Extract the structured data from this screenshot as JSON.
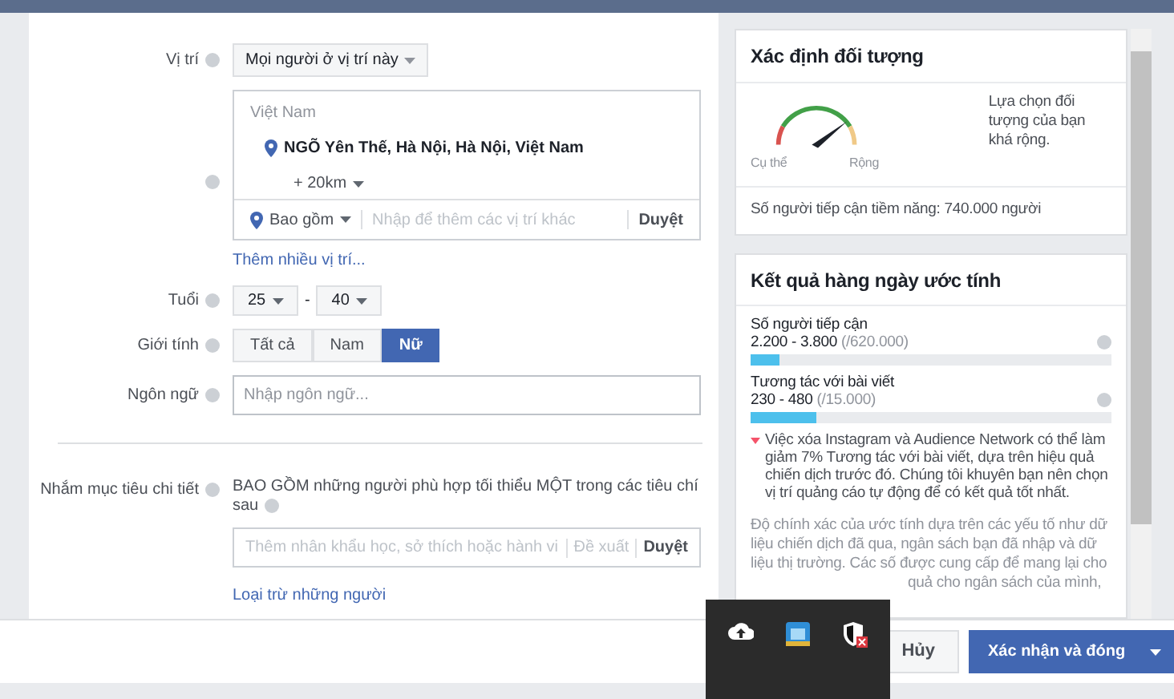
{
  "form": {
    "location": {
      "label": "Vị trí",
      "mode": "Mọi người ở vị trí này",
      "country": "Việt Nam",
      "place": "NGÕ Yên Thế, Hà Nội, Hà Nội, Việt Nam",
      "radius": "+ 20km",
      "include": "Bao gồm",
      "placeholder": "Nhập để thêm các vị trí khác",
      "browse": "Duyệt",
      "more": "Thêm nhiều vị trí..."
    },
    "age": {
      "label": "Tuổi",
      "from": "25",
      "separator": "-",
      "to": "40"
    },
    "gender": {
      "label": "Giới tính",
      "options": [
        {
          "label": "Tất cả",
          "selected": false
        },
        {
          "label": "Nam",
          "selected": false
        },
        {
          "label": "Nữ",
          "selected": true
        }
      ]
    },
    "language": {
      "label": "Ngôn ngữ",
      "placeholder": "Nhập ngôn ngữ..."
    },
    "detailed": {
      "label": "Nhắm mục tiêu chi tiết",
      "description": "BAO GỒM những người phù hợp tối thiểu MỘT trong các tiêu chí sau",
      "placeholder": "Thêm nhân khẩu học, sở thích hoặc hành vi",
      "suggest": "Đề xuất",
      "browse": "Duyệt",
      "exclude": "Loại trừ những người"
    }
  },
  "audience": {
    "title": "Xác định đối tượng",
    "gauge": {
      "min_label": "Cụ thể",
      "max_label": "Rộng"
    },
    "note": "Lựa chọn đối tượng của bạn khá rộng.",
    "reach": "Số người tiếp cận tiềm năng: 740.000 người"
  },
  "results": {
    "title": "Kết quả hàng ngày ước tính",
    "metrics": [
      {
        "name": "Số người tiếp cận",
        "range": "2.200 - 3.800",
        "total": "(/620.000)",
        "level": 0.08
      },
      {
        "name": "Tương tác với bài viết",
        "range": "230 - 480",
        "total": "(/15.000)",
        "level": 0.18
      }
    ],
    "warning": "Việc xóa Instagram và Audience Network có thể làm giảm 7% Tương tác với bài viết, dựa trên hiệu quả chiến dịch trước đó. Chúng tôi khuyên bạn nên chọn vị trí quảng cáo tự động để có kết quả tốt nhất.",
    "disclaimer": "Độ chính xác của ước tính dựa trên các yếu tố như dữ liệu chiến dịch đã qua, ngân sách bạn đã nhập và dữ liệu thị trường. Các số được cung cấp để mang lại cho",
    "disclaimer_tail": "quả cho ngân sách của mình,"
  },
  "footer": {
    "cancel": "Hủy",
    "confirm": "Xác nhận và đóng"
  }
}
